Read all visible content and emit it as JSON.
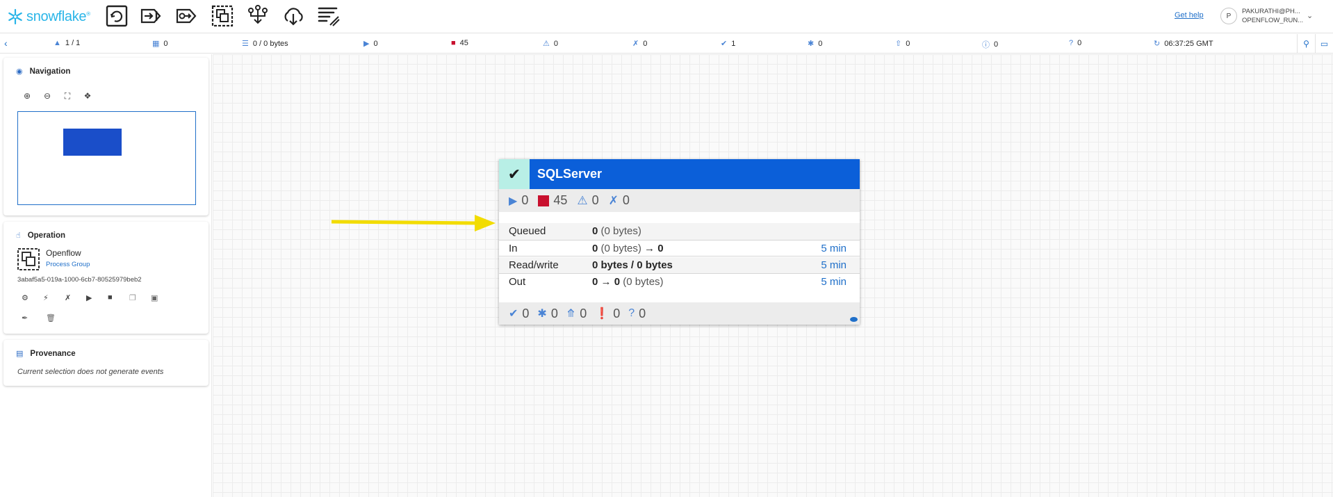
{
  "header": {
    "logo_text": "snowflake",
    "logo_sup": "®",
    "tools": [
      "processor-icon",
      "input-port-icon",
      "output-port-icon",
      "process-group-icon",
      "remote-process-group-icon",
      "funnel-icon",
      "template-icon",
      "label-icon"
    ],
    "help_label": "Get help",
    "user_initial": "P",
    "user_name": "PAKURATHI@PH...",
    "user_role": "OPENFLOW_RUN...",
    "brand_color": "#29b5e8"
  },
  "statusbar": {
    "clusters": "1 / 1",
    "threads": "0",
    "queued": "0 / 0 bytes",
    "running": "0",
    "stopped": "45",
    "invalid": "0",
    "disabled": "0",
    "up_to_date": "1",
    "locally_modified": "0",
    "stale": "0",
    "errors": "0",
    "unknown": "0",
    "refresh_time": "06:37:25 GMT"
  },
  "navigation": {
    "title": "Navigation"
  },
  "operation": {
    "title": "Operation",
    "name": "Openflow",
    "type": "Process Group",
    "id": "3abaf5a5-019a-1000-6cb7-80525979beb2"
  },
  "provenance": {
    "title": "Provenance",
    "message": "Current selection does not generate events"
  },
  "process_group": {
    "title": "SQLServer",
    "running": "0",
    "stopped": "45",
    "invalid": "0",
    "disabled": "0",
    "queued_label": "Queued",
    "queued_count": "0",
    "queued_bytes": "(0 bytes)",
    "in_label": "In",
    "in_count": "0",
    "in_bytes": "(0 bytes)",
    "in_arrow": "→",
    "in_out_count": "0",
    "in_time": "5 min",
    "rw_label": "Read/write",
    "rw_value": "0 bytes / 0 bytes",
    "rw_time": "5 min",
    "out_label": "Out",
    "out_count": "0",
    "out_arrow": "→",
    "out_out_count": "0",
    "out_bytes": "(0 bytes)",
    "out_time": "5 min",
    "up_to_date": "0",
    "locally_modified": "0",
    "stale": "0",
    "sync_failure": "0",
    "unknown": "0",
    "header_color": "#0b5fd9",
    "stopped_color": "#c8102e"
  },
  "annotation": {
    "arrow_color": "#f2dc00"
  }
}
